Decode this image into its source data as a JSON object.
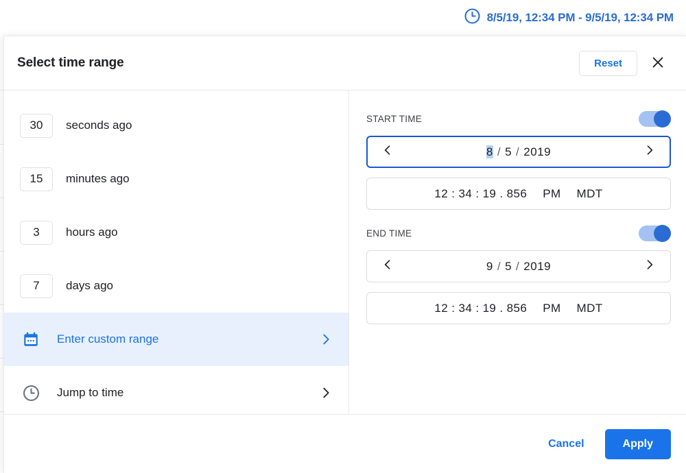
{
  "top_bar": {
    "icon": "clock-icon",
    "range_text": "8/5/19, 12:34 PM - 9/5/19, 12:34 PM",
    "accent_color": "#2b6cd4"
  },
  "dialog": {
    "title": "Select time range",
    "reset_label": "Reset",
    "close_icon": "close-icon",
    "presets": [
      {
        "value": "30",
        "label": "seconds ago"
      },
      {
        "value": "15",
        "label": "minutes ago"
      },
      {
        "value": "3",
        "label": "hours ago"
      },
      {
        "value": "7",
        "label": "days ago"
      }
    ],
    "nav_items": [
      {
        "label": "Enter custom range",
        "icon": "calendar-icon",
        "chevron": "chevron-right-icon",
        "selected": true
      },
      {
        "label": "Jump to time",
        "icon": "clock-icon",
        "chevron": "chevron-right-icon",
        "selected": false
      }
    ],
    "start_time": {
      "section_label": "START TIME",
      "toggle_on": true,
      "prev_icon": "chevron-left-icon",
      "next_icon": "chevron-right-icon",
      "month": "8",
      "day": "5",
      "year": "2019",
      "month_selected": true,
      "time": "12 : 34 : 19 . 856",
      "meridiem": "PM",
      "timezone": "MDT"
    },
    "end_time": {
      "section_label": "END TIME",
      "toggle_on": true,
      "prev_icon": "chevron-left-icon",
      "next_icon": "chevron-right-icon",
      "month": "9",
      "day": "5",
      "year": "2019",
      "month_selected": false,
      "time": "12 : 34 : 19 . 856",
      "meridiem": "PM",
      "timezone": "MDT"
    },
    "footer": {
      "cancel_label": "Cancel",
      "apply_label": "Apply"
    }
  },
  "colors": {
    "accent": "#1a73e8",
    "selected_row_bg": "#e8f0fe",
    "focus_border": "#1a56d6",
    "text_selection": "#b3d3f5"
  }
}
